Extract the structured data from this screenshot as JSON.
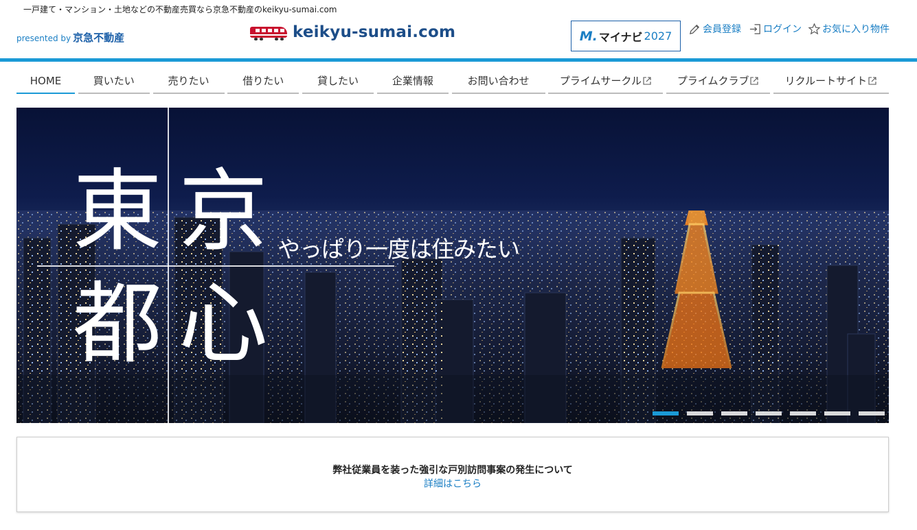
{
  "header": {
    "tagline": "一戸建て・マンション・土地などの不動産売買なら京急不動産のkeikyu-sumai.com",
    "presented_by": "presented by",
    "company": "京急不動産",
    "site_name": "keikyu-sumai.com",
    "mynavi": {
      "mark": "M.",
      "label": "マイナビ",
      "year": "2027"
    },
    "util_links": [
      {
        "label": "会員登録",
        "icon": "pencil-icon"
      },
      {
        "label": "ログイン",
        "icon": "login-icon"
      },
      {
        "label": "お気に入り物件",
        "icon": "star-icon"
      }
    ]
  },
  "nav": {
    "items": [
      {
        "label": "HOME",
        "active": true
      },
      {
        "label": "買いたい"
      },
      {
        "label": "売りたい"
      },
      {
        "label": "借りたい"
      },
      {
        "label": "貸したい"
      },
      {
        "label": "企業情報"
      },
      {
        "label": "お問い合わせ"
      },
      {
        "label": "プライムサークル",
        "external": true
      },
      {
        "label": "プライムクラブ",
        "external": true
      },
      {
        "label": "リクルートサイト",
        "external": true
      }
    ]
  },
  "hero": {
    "kanji": [
      "東",
      "京",
      "都",
      "心"
    ],
    "subtitle": "やっぱり一度は住みたい",
    "slides_total": 7,
    "slide_active": 1
  },
  "notice": {
    "title": "弊社従業員を装った強引な戸別訪問事案の発生について",
    "link": "詳細はこちら"
  },
  "colors": {
    "accent": "#1b9ad6",
    "link": "#1b7fc4",
    "brand_navy": "#1d4e89",
    "train_red": "#c8102e"
  }
}
